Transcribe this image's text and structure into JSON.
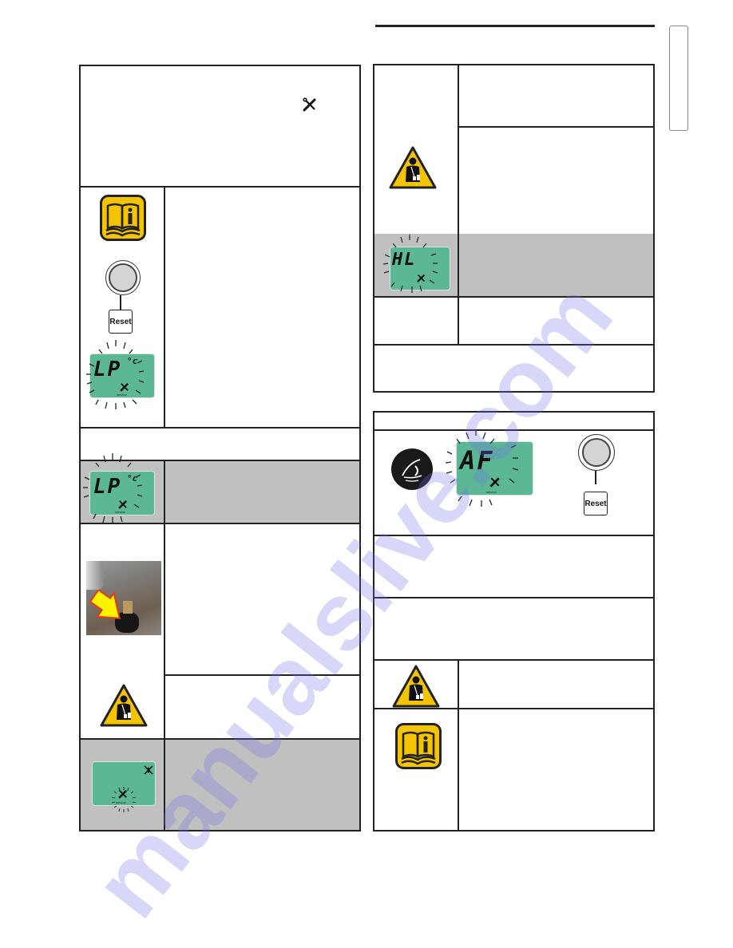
{
  "page": {
    "watermark": "manualslive.com"
  },
  "lcd": {
    "lp_code": "LP",
    "lp_unit": "°c",
    "hl_code": "HL",
    "af_code": "AF",
    "service_label": "service"
  },
  "buttons": {
    "reset_label": "Reset"
  },
  "colors": {
    "lcd_green": "#5cb894",
    "warning_yellow": "#f5c400",
    "shaded_row": "#c0c0c0",
    "rule": "#222222"
  }
}
